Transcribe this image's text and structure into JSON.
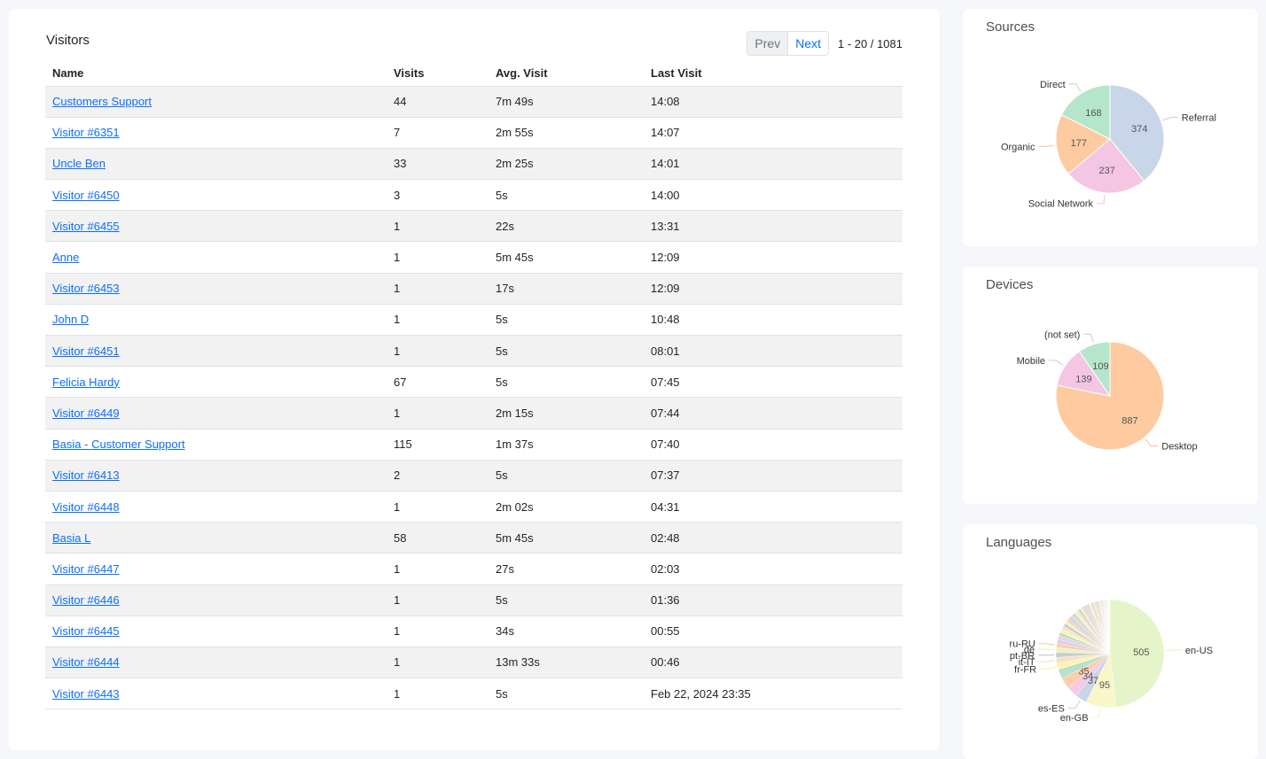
{
  "visitors": {
    "title": "Visitors",
    "prev_label": "Prev",
    "next_label": "Next",
    "range_text": "1 - 20 / 1081",
    "columns": [
      "Name",
      "Visits",
      "Avg. Visit",
      "Last Visit"
    ],
    "rows": [
      {
        "name": "Customers Support",
        "visits": "44",
        "avg": "7m 49s",
        "last": "14:08"
      },
      {
        "name": "Visitor #6351",
        "visits": "7",
        "avg": "2m 55s",
        "last": "14:07"
      },
      {
        "name": "Uncle Ben",
        "visits": "33",
        "avg": "2m 25s",
        "last": "14:01"
      },
      {
        "name": "Visitor #6450",
        "visits": "3",
        "avg": "5s",
        "last": "14:00"
      },
      {
        "name": "Visitor #6455",
        "visits": "1",
        "avg": "22s",
        "last": "13:31"
      },
      {
        "name": "Anne",
        "visits": "1",
        "avg": "5m 45s",
        "last": "12:09"
      },
      {
        "name": "Visitor #6453",
        "visits": "1",
        "avg": "17s",
        "last": "12:09"
      },
      {
        "name": "John D",
        "visits": "1",
        "avg": "5s",
        "last": "10:48"
      },
      {
        "name": "Visitor #6451",
        "visits": "1",
        "avg": "5s",
        "last": "08:01"
      },
      {
        "name": "Felicia Hardy",
        "visits": "67",
        "avg": "5s",
        "last": "07:45"
      },
      {
        "name": "Visitor #6449",
        "visits": "1",
        "avg": "2m 15s",
        "last": "07:44"
      },
      {
        "name": "Basia - Customer Support",
        "visits": "115",
        "avg": "1m 37s",
        "last": "07:40"
      },
      {
        "name": "Visitor #6413",
        "visits": "2",
        "avg": "5s",
        "last": "07:37"
      },
      {
        "name": "Visitor #6448",
        "visits": "1",
        "avg": "2m 02s",
        "last": "04:31"
      },
      {
        "name": "Basia L",
        "visits": "58",
        "avg": "5m 45s",
        "last": "02:48"
      },
      {
        "name": "Visitor #6447",
        "visits": "1",
        "avg": "27s",
        "last": "02:03"
      },
      {
        "name": "Visitor #6446",
        "visits": "1",
        "avg": "5s",
        "last": "01:36"
      },
      {
        "name": "Visitor #6445",
        "visits": "1",
        "avg": "34s",
        "last": "00:55"
      },
      {
        "name": "Visitor #6444",
        "visits": "1",
        "avg": "13m 33s",
        "last": "00:46"
      },
      {
        "name": "Visitor #6443",
        "visits": "1",
        "avg": "5s",
        "last": "Feb 22, 2024 23:35"
      }
    ]
  },
  "chart_data": [
    {
      "type": "pie",
      "title": "Sources",
      "slices": [
        {
          "label": "Referral",
          "value": 374,
          "color": "#c9d5e8"
        },
        {
          "label": "Social Network",
          "value": 237,
          "color": "#f4c6e3"
        },
        {
          "label": "Organic",
          "value": 177,
          "color": "#fecba1"
        },
        {
          "label": "Direct",
          "value": 168,
          "color": "#b5e5cb"
        }
      ]
    },
    {
      "type": "pie",
      "title": "Devices",
      "slices": [
        {
          "label": "Desktop",
          "value": 887,
          "color": "#fecba1"
        },
        {
          "label": "Mobile",
          "value": 139,
          "color": "#f4c6e3"
        },
        {
          "label": "(not set)",
          "value": 109,
          "color": "#b5e5cb"
        }
      ]
    },
    {
      "type": "pie",
      "title": "Languages",
      "slices": [
        {
          "label": "en-US",
          "value": 505,
          "color": "#e6f5c9"
        },
        {
          "label": "en-GB",
          "value": 95,
          "color": "#f9f6c8"
        },
        {
          "label": "es-ES",
          "value": 37,
          "color": "#cbd5e8"
        },
        {
          "label": "",
          "value": 34,
          "color": "#f4cae4"
        },
        {
          "label": "",
          "value": 35,
          "color": "#fdcdac"
        },
        {
          "label": "",
          "value": 30,
          "color": "#b3e2cd"
        },
        {
          "label": "fr-FR",
          "value": 20,
          "color": "#fff2ae"
        },
        {
          "label": "it-IT",
          "value": 18,
          "color": "#f1e2cc"
        },
        {
          "label": "pt-BR",
          "value": 16,
          "color": "#cccccc"
        },
        {
          "label": "de",
          "value": 15,
          "color": "#e6f5c9"
        },
        {
          "label": "ru-RU",
          "value": 14,
          "color": "#fdcdac"
        },
        {
          "label": "",
          "value": 12,
          "color": "#cbd5e8"
        },
        {
          "label": "",
          "value": 12,
          "color": "#f4cae4"
        },
        {
          "label": "",
          "value": 11,
          "color": "#b3e2cd"
        },
        {
          "label": "",
          "value": 11,
          "color": "#fff2ae"
        },
        {
          "label": "",
          "value": 10,
          "color": "#f1e2cc"
        },
        {
          "label": "",
          "value": 10,
          "color": "#cccccc"
        },
        {
          "label": "",
          "value": 9,
          "color": "#e6f5c9"
        },
        {
          "label": "",
          "value": 9,
          "color": "#fdcdac"
        },
        {
          "label": "",
          "value": 9,
          "color": "#cbd5e8"
        },
        {
          "label": "",
          "value": 8,
          "color": "#f4cae4"
        },
        {
          "label": "",
          "value": 8,
          "color": "#b3e2cd"
        },
        {
          "label": "",
          "value": 8,
          "color": "#fff2ae"
        },
        {
          "label": "",
          "value": 7,
          "color": "#f1e2cc"
        },
        {
          "label": "",
          "value": 7,
          "color": "#cccccc"
        },
        {
          "label": "",
          "value": 7,
          "color": "#e6f5c9"
        },
        {
          "label": "",
          "value": 6,
          "color": "#fdcdac"
        },
        {
          "label": "",
          "value": 6,
          "color": "#cbd5e8"
        },
        {
          "label": "",
          "value": 6,
          "color": "#f4cae4"
        },
        {
          "label": "",
          "value": 5,
          "color": "#b3e2cd"
        },
        {
          "label": "",
          "value": 5,
          "color": "#fff2ae"
        },
        {
          "label": "",
          "value": 5,
          "color": "#f1e2cc"
        },
        {
          "label": "",
          "value": 5,
          "color": "#cccccc"
        },
        {
          "label": "",
          "value": 4,
          "color": "#e6f5c9"
        },
        {
          "label": "",
          "value": 4,
          "color": "#fdcdac"
        },
        {
          "label": "",
          "value": 4,
          "color": "#cbd5e8"
        },
        {
          "label": "",
          "value": 4,
          "color": "#f4cae4"
        },
        {
          "label": "",
          "value": 3,
          "color": "#b3e2cd"
        },
        {
          "label": "",
          "value": 3,
          "color": "#fff2ae"
        },
        {
          "label": "",
          "value": 3,
          "color": "#f1e2cc"
        },
        {
          "label": "",
          "value": 3,
          "color": "#cccccc"
        },
        {
          "label": "",
          "value": 3,
          "color": "#e6f5c9"
        },
        {
          "label": "",
          "value": 2,
          "color": "#fdcdac"
        },
        {
          "label": "",
          "value": 2,
          "color": "#cbd5e8"
        },
        {
          "label": "",
          "value": 2,
          "color": "#f4cae4"
        },
        {
          "label": "",
          "value": 2,
          "color": "#b3e2cd"
        },
        {
          "label": "",
          "value": 2,
          "color": "#fff2ae"
        },
        {
          "label": "",
          "value": 2,
          "color": "#f1e2cc"
        },
        {
          "label": "",
          "value": 2,
          "color": "#cccccc"
        },
        {
          "label": "",
          "value": 2,
          "color": "#e6f5c9"
        },
        {
          "label": "",
          "value": 1,
          "color": "#fdcdac"
        },
        {
          "label": "",
          "value": 1,
          "color": "#cbd5e8"
        },
        {
          "label": "",
          "value": 1,
          "color": "#f4cae4"
        },
        {
          "label": "",
          "value": 1,
          "color": "#b3e2cd"
        },
        {
          "label": "",
          "value": 1,
          "color": "#fff2ae"
        },
        {
          "label": "",
          "value": 1,
          "color": "#f1e2cc"
        }
      ]
    }
  ]
}
